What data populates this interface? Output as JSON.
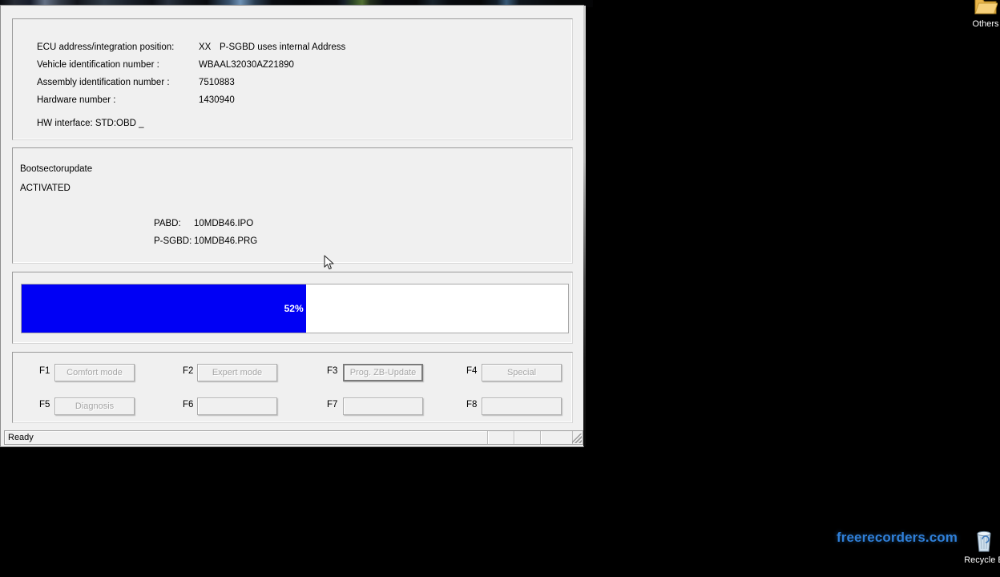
{
  "desktop": {
    "icons": [
      {
        "name": "others-folder",
        "label": "Others",
        "glyph": "📁"
      },
      {
        "name": "recycle-bin",
        "label": "Recycle B",
        "glyph": "🗑"
      }
    ],
    "watermark": "freerecorders.com",
    "watermark_color": "#2f7fd8"
  },
  "window": {
    "info_panel": {
      "rows": [
        {
          "label": "ECU address/integration position:",
          "code": "XX",
          "value": "P-SGBD uses internal Address"
        },
        {
          "label": "Vehicle identification number :",
          "value": "WBAAL32030AZ21890"
        },
        {
          "label": "Assembly identification number :",
          "value": "7510883"
        },
        {
          "label": "Hardware number :",
          "value": "1430940"
        }
      ],
      "hw_interface": "HW interface:  STD:OBD _"
    },
    "status_panel": {
      "title": "Bootsectorupdate",
      "state": "ACTIVATED",
      "files": [
        {
          "label": "PABD:",
          "value": "10MDB46.IPO"
        },
        {
          "label": "P-SGBD:",
          "value": "10MDB46.PRG"
        }
      ]
    },
    "progress": {
      "percent": 52,
      "percent_label": "52%",
      "fill_color": "#0000f5"
    },
    "function_buttons": [
      {
        "key": "F1",
        "label": "Comfort mode",
        "disabled": true,
        "focused": false
      },
      {
        "key": "F2",
        "label": "Expert mode",
        "disabled": true,
        "focused": false
      },
      {
        "key": "F3",
        "label": "Prog. ZB-Update",
        "disabled": true,
        "focused": true
      },
      {
        "key": "F4",
        "label": "Special",
        "disabled": true,
        "focused": false
      },
      {
        "key": "F5",
        "label": "Diagnosis",
        "disabled": true,
        "focused": false
      },
      {
        "key": "F6",
        "label": "",
        "disabled": true,
        "focused": false
      },
      {
        "key": "F7",
        "label": "",
        "disabled": true,
        "focused": false
      },
      {
        "key": "F8",
        "label": "",
        "disabled": true,
        "focused": false
      }
    ],
    "status_bar": {
      "text": "Ready"
    }
  }
}
